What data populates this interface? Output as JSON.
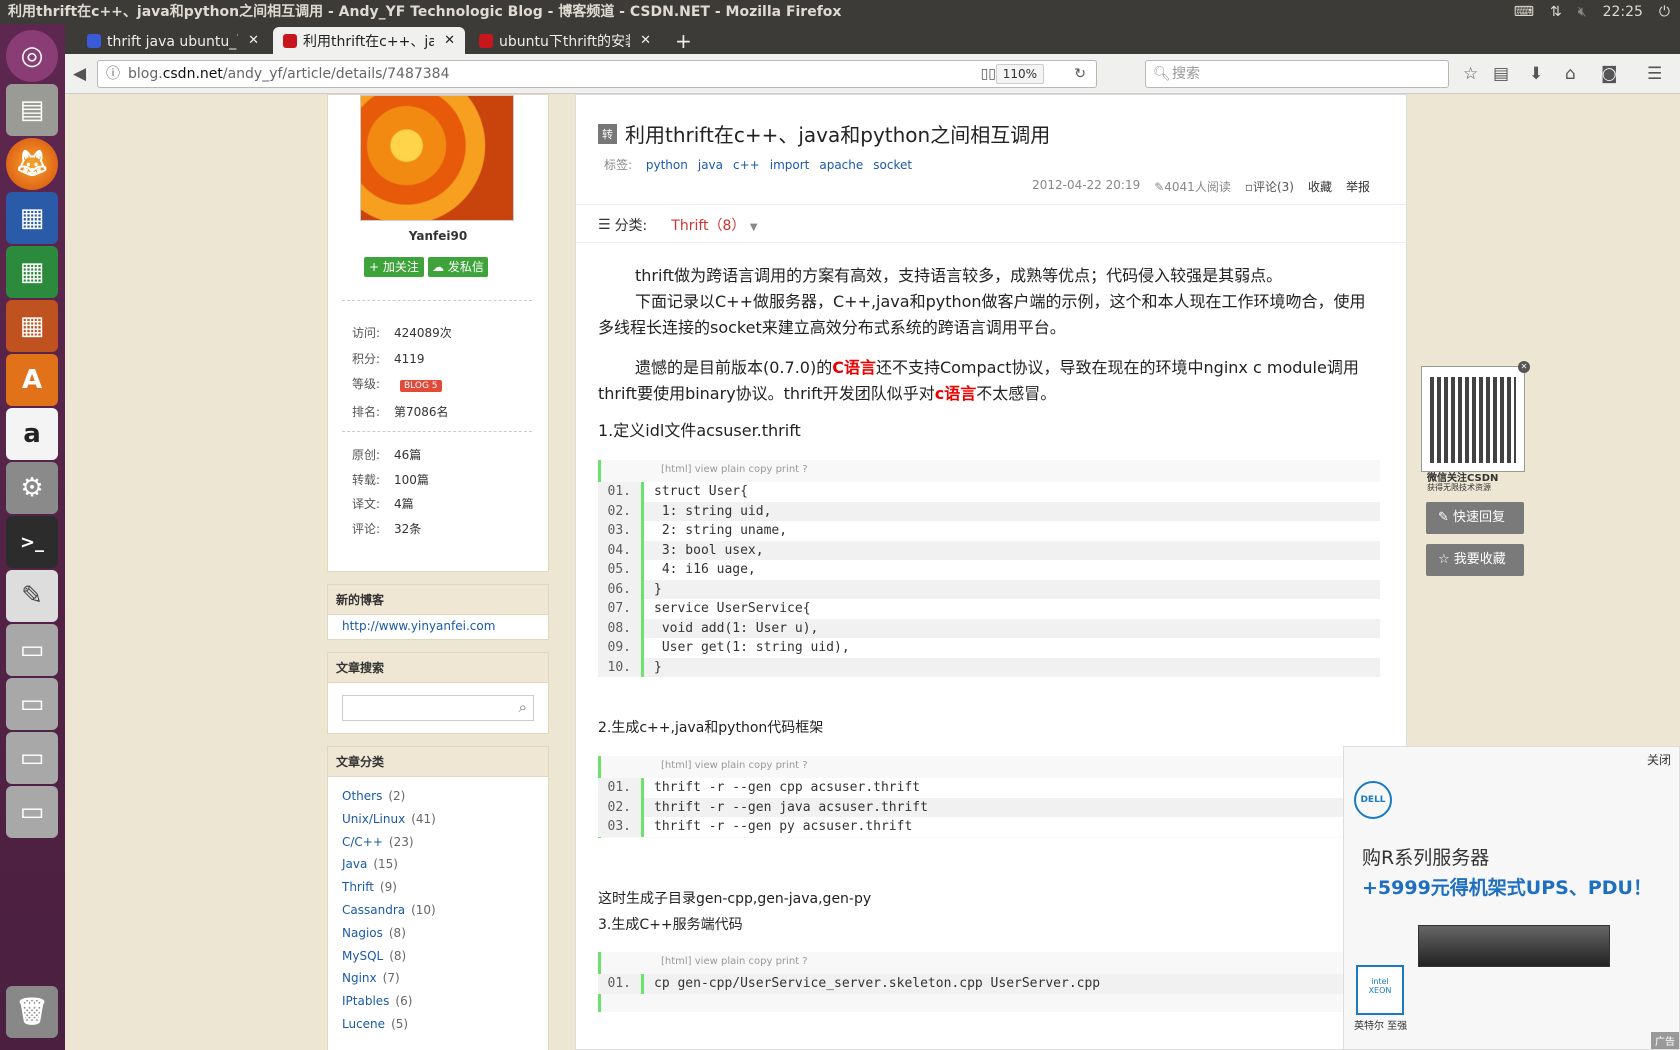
{
  "os": {
    "window_title": "利用thrift在c++、java和python之间相互调用 - Andy_YF Technologic Blog - 博客频道 - CSDN.NET - Mozilla Firefox",
    "clock": "22:25",
    "tray_icons": [
      "keyboard-icon",
      "network-icon",
      "volume-mute-icon",
      "settings-icon"
    ]
  },
  "launcher": [
    "ubuntu-dash-icon",
    "files-icon",
    "firefox-icon",
    "writer-icon",
    "calc-icon",
    "impress-icon",
    "software-center-icon",
    "amazon-icon",
    "system-settings-icon",
    "terminal-icon",
    "text-editor-icon",
    "drive-icon",
    "drive-icon",
    "drive-icon",
    "drive-icon",
    "trash-icon"
  ],
  "tabs": [
    {
      "label": "thrift java ubuntu_百度",
      "color": "#3a5bd9"
    },
    {
      "label": "利用thrift在c++、java和",
      "color": "#c8161d"
    },
    {
      "label": "ubuntu下thrift的安装",
      "color": "#c8161d"
    }
  ],
  "url": {
    "prefix": "blog.",
    "domain": "csdn.net",
    "path": "/andy_yf/article/details/7487384"
  },
  "zoom": "110%",
  "search_placeholder": "搜索",
  "sidebar": {
    "username": "Yanfei90",
    "follow_btn": "加关注",
    "message_btn": "发私信",
    "stats": [
      {
        "k": "访问:",
        "v": "424089次"
      },
      {
        "k": "积分:",
        "v": "4119"
      },
      {
        "k": "等级:",
        "v": "BLOG 5"
      },
      {
        "k": "排名:",
        "v": "第7086名"
      }
    ],
    "counts": [
      {
        "k": "原创:",
        "v": "46篇"
      },
      {
        "k": "转载:",
        "v": "100篇"
      },
      {
        "k": "译文:",
        "v": "4篇"
      },
      {
        "k": "评论:",
        "v": "32条"
      }
    ],
    "new_blog_title": "新的博客",
    "new_blog_link": "http://www.yinyanfei.com",
    "search_title": "文章搜索",
    "category_title": "文章分类",
    "categories": [
      {
        "name": "Others",
        "count": "(2)"
      },
      {
        "name": "Unix/Linux",
        "count": "(41)"
      },
      {
        "name": "C/C++",
        "count": "(23)"
      },
      {
        "name": "Java",
        "count": "(15)"
      },
      {
        "name": "Thrift",
        "count": "(9)"
      },
      {
        "name": "Cassandra",
        "count": "(10)"
      },
      {
        "name": "Nagios",
        "count": "(8)"
      },
      {
        "name": "MySQL",
        "count": "(8)"
      },
      {
        "name": "Nginx",
        "count": "(7)"
      },
      {
        "name": "IPtables",
        "count": "(6)"
      },
      {
        "name": "Lucene",
        "count": "(5)"
      }
    ]
  },
  "article": {
    "badge": "转",
    "title": "利用thrift在c++、java和python之间相互调用",
    "tags_label": "标签:",
    "tags": [
      "python",
      "java",
      "c++",
      "import",
      "apache",
      "socket"
    ],
    "date": "2012-04-22 20:19",
    "reads": "4041人阅读",
    "comments": "评论(3)",
    "favorite": "收藏",
    "report": "举报",
    "category_label": "分类:",
    "category_value": "Thrift（8）",
    "p1": "thrift做为跨语言调用的方案有高效，支持语言较多，成熟等优点；代码侵入较强是其弱点。",
    "p2": "下面记录以C++做服务器，C++,java和python做客户端的示例，这个和本人现在工作环境吻合，使用多线程长连接的socket来建立高效分布式系统的跨语言调用平台。",
    "p3a": "遗憾的是目前版本(0.7.0)的",
    "p3b": "C语言",
    "p3c": "还不支持Compact协议，导致在现在的环境中nginx c module调用thrift要使用binary协议。thrift开发团队似乎对",
    "p3d": "c语言",
    "p3e": "不太感冒。",
    "h1": "1.定义idl文件acsuser.thrift",
    "code_toolbar": "[html] view plain    copy    print    ?",
    "code1": [
      {
        "n": "01.",
        "c": "struct User{"
      },
      {
        "n": "02.",
        "c": " 1: string uid,"
      },
      {
        "n": "03.",
        "c": " 2: string uname,"
      },
      {
        "n": "04.",
        "c": " 3: bool usex,"
      },
      {
        "n": "05.",
        "c": " 4: i16 uage,"
      },
      {
        "n": "06.",
        "c": "}"
      },
      {
        "n": "07.",
        "c": "service UserService{"
      },
      {
        "n": "08.",
        "c": " void add(1: User u),"
      },
      {
        "n": "09.",
        "c": " User get(1: string uid),"
      },
      {
        "n": "10.",
        "c": "}"
      }
    ],
    "h2": "2.生成c++,java和python代码框架",
    "code2": [
      {
        "n": "01.",
        "c": "thrift -r --gen cpp acsuser.thrift"
      },
      {
        "n": "02.",
        "c": "thrift -r --gen java acsuser.thrift"
      },
      {
        "n": "03.",
        "c": "thrift -r --gen py acsuser.thrift"
      }
    ],
    "p4": "这时生成子目录gen-cpp,gen-java,gen-py",
    "h3": "3.生成C++服务端代码",
    "code3_first": "cp gen-cpp/UserService_server.skeleton.cpp UserServer.cpp"
  },
  "right_rail": {
    "qr_caption1": "微信关注CSDN",
    "qr_caption2": "获得无限技术资源",
    "quick_reply": "快速回复",
    "my_favorite": "我要收藏"
  },
  "ad": {
    "close": "关闭",
    "brand": "DELL",
    "line1": "购R系列服务器",
    "line2": "+5999元得机架式UPS、PDU！",
    "intel": "英特尔 至强",
    "ad_label": "广告"
  }
}
